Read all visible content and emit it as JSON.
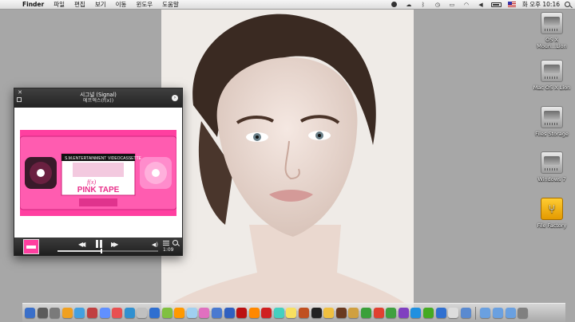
{
  "menubar": {
    "apple_glyph": "",
    "app_name": "Finder",
    "menus": [
      "파일",
      "편집",
      "보기",
      "이동",
      "윈도우",
      "도움말"
    ],
    "input_flag": "us-flag",
    "clock": "화 오후 10:16"
  },
  "desktop_icons": [
    {
      "label": "OS X Moun...Lion",
      "icon": "hard-drive-icon"
    },
    {
      "label": "Mac OS X Lion",
      "icon": "hard-drive-icon"
    },
    {
      "label": "Files Storage",
      "icon": "hard-drive-icon"
    },
    {
      "label": "Windows 7",
      "icon": "hard-drive-icon"
    },
    {
      "label": "File Factory",
      "icon": "usb-drive-icon"
    }
  ],
  "player": {
    "song_title": "시그널 (Signal)",
    "artist": "에프엑스(f(x))",
    "elapsed": "1:09",
    "progress_fraction": 0.43,
    "artwork": {
      "header": "S.M.ENTERTAINMENT",
      "brand": "VIDEOCASSETTE",
      "script_title": "f(x)",
      "title": "PINK TAPE"
    }
  },
  "dock": {
    "colors": [
      "#3a6fc9",
      "#5b5b5b",
      "#7a7a7a",
      "#f0a020",
      "#44a0e0",
      "#c04040",
      "#6090ff",
      "#e85050",
      "#3090d0",
      "#c0c0c0",
      "#2f6fd0",
      "#80c040",
      "#ff9900",
      "#a0d0f0",
      "#e070c0",
      "#4a7ad0",
      "#3060c0",
      "#bb1111",
      "#ff8800",
      "#d02020",
      "#44d0c0",
      "#f8e060",
      "#c05020",
      "#222222",
      "#f0c040",
      "#6a3a20",
      "#d0a040",
      "#3aa03a",
      "#e04030",
      "#40a040",
      "#8040c0",
      "#2090e0",
      "#44aa22",
      "#3070d0",
      "#ddd",
      "#5a8ad0"
    ],
    "folder_colors": [
      "#6aa0e0",
      "#6aa0e0",
      "#6aa0e0",
      "#808080"
    ]
  }
}
